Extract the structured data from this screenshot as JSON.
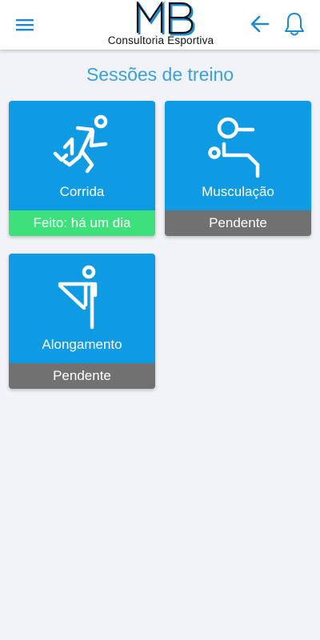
{
  "header": {
    "logo_text": "MB",
    "logo_subtitle": "Consultoria Esportiva"
  },
  "page_title": "Sessões de treino",
  "sessions": [
    {
      "label": "Corrida",
      "status": "Feito: há um dia",
      "state": "done",
      "icon": "running-icon"
    },
    {
      "label": "Musculação",
      "status": "Pendente",
      "state": "pending",
      "icon": "weightlifting-icon"
    },
    {
      "label": "Alongamento",
      "status": "Pendente",
      "state": "pending",
      "icon": "stretching-icon"
    }
  ],
  "colors": {
    "accent": "#1e88d4",
    "card": "#0e9be3",
    "status_done": "#3ee07c",
    "status_pending": "#717171",
    "title": "#3aa1dc"
  }
}
